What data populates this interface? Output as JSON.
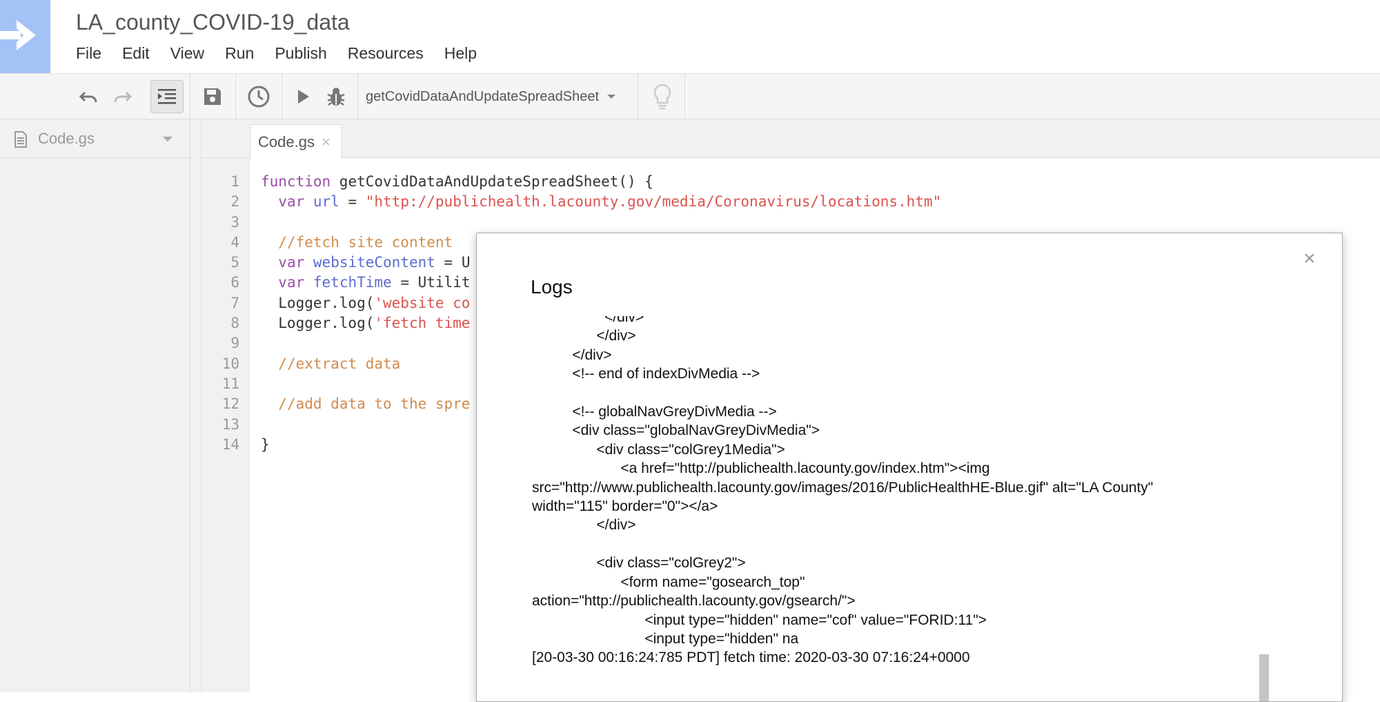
{
  "header": {
    "title": "LA_county_COVID-19_data",
    "menu": [
      "File",
      "Edit",
      "View",
      "Run",
      "Publish",
      "Resources",
      "Help"
    ]
  },
  "toolbar": {
    "undo": "undo-icon",
    "redo": "redo-icon",
    "format": "indent-icon",
    "save": "save-icon",
    "triggers": "clock-icon",
    "run": "play-icon",
    "debug": "bug-icon",
    "function_select": "getCovidDataAndUpdateSpreadSheet",
    "lightbulb": "lightbulb-icon"
  },
  "sidebar": {
    "file_label": "Code.gs"
  },
  "editor": {
    "tab_label": "Code.gs",
    "line_numbers": [
      "1",
      "2",
      "3",
      "4",
      "5",
      "6",
      "7",
      "8",
      "9",
      "10",
      "11",
      "12",
      "13",
      "14"
    ],
    "lines": [
      [
        {
          "c": "kw",
          "t": "function"
        },
        {
          "c": "fn",
          "t": " getCovidDataAndUpdateSpreadSheet() {"
        }
      ],
      [
        {
          "c": "fn",
          "t": "  "
        },
        {
          "c": "kw",
          "t": "var"
        },
        {
          "c": "fn",
          "t": " "
        },
        {
          "c": "var",
          "t": "url"
        },
        {
          "c": "fn",
          "t": " = "
        },
        {
          "c": "str",
          "t": "\"http://publichealth.lacounty.gov/media/Coronavirus/locations.htm\""
        }
      ],
      [
        {
          "c": "fn",
          "t": " "
        }
      ],
      [
        {
          "c": "fn",
          "t": "  "
        },
        {
          "c": "cmt",
          "t": "//fetch site content"
        }
      ],
      [
        {
          "c": "fn",
          "t": "  "
        },
        {
          "c": "kw",
          "t": "var"
        },
        {
          "c": "fn",
          "t": " "
        },
        {
          "c": "var",
          "t": "websiteContent"
        },
        {
          "c": "fn",
          "t": " = U"
        }
      ],
      [
        {
          "c": "fn",
          "t": "  "
        },
        {
          "c": "kw",
          "t": "var"
        },
        {
          "c": "fn",
          "t": " "
        },
        {
          "c": "var",
          "t": "fetchTime"
        },
        {
          "c": "fn",
          "t": " = Utilit"
        }
      ],
      [
        {
          "c": "fn",
          "t": "  Logger.log("
        },
        {
          "c": "str",
          "t": "'website co"
        }
      ],
      [
        {
          "c": "fn",
          "t": "  Logger.log("
        },
        {
          "c": "str",
          "t": "'fetch time"
        }
      ],
      [
        {
          "c": "fn",
          "t": " "
        }
      ],
      [
        {
          "c": "fn",
          "t": "  "
        },
        {
          "c": "cmt",
          "t": "//extract data"
        }
      ],
      [
        {
          "c": "fn",
          "t": " "
        }
      ],
      [
        {
          "c": "fn",
          "t": "  "
        },
        {
          "c": "cmt",
          "t": "//add data to the spre"
        }
      ],
      [
        {
          "c": "fn",
          "t": " "
        }
      ],
      [
        {
          "c": "fn",
          "t": "}"
        }
      ]
    ]
  },
  "log_dialog": {
    "title": "Logs",
    "close": "×",
    "lines": [
      "                  </div>",
      "                </div>",
      "          </div>",
      "          <!-- end of indexDivMedia -->",
      "",
      "          <!-- globalNavGreyDivMedia -->",
      "          <div class=\"globalNavGreyDivMedia\">",
      "                <div class=\"colGrey1Media\">",
      "                      <a href=\"http://publichealth.lacounty.gov/index.htm\"><img",
      "src=\"http://www.publichealth.lacounty.gov/images/2016/PublicHealthHE-Blue.gif\" alt=\"LA County\"",
      "width=\"115\" border=\"0\"></a>",
      "                </div>",
      "",
      "                <div class=\"colGrey2\">",
      "                      <form name=\"gosearch_top\"",
      "action=\"http://publichealth.lacounty.gov/gsearch/\">",
      "                            <input type=\"hidden\" name=\"cof\" value=\"FORID:11\">",
      "                            <input type=\"hidden\" na",
      "[20-03-30 00:16:24:785 PDT] fetch time: 2020-03-30 07:16:24+0000"
    ]
  }
}
